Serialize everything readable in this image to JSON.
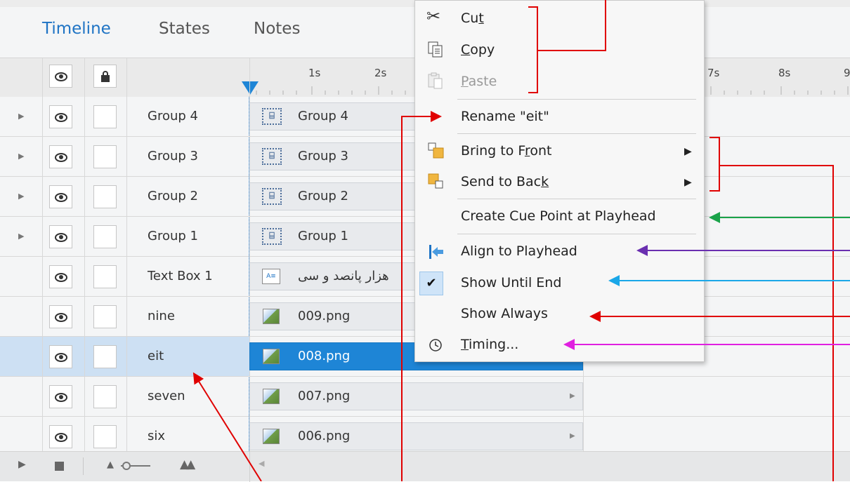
{
  "tabs": [
    {
      "label": "Timeline",
      "active": true
    },
    {
      "label": "States",
      "active": false
    },
    {
      "label": "Notes",
      "active": false
    }
  ],
  "ruler": {
    "ticks": [
      "1s",
      "2s",
      "7s",
      "8s",
      "9"
    ]
  },
  "layers": [
    {
      "name": "Group 4",
      "expandable": true,
      "bar_label": "Group  4",
      "bar_icon": "group-icon"
    },
    {
      "name": "Group 3",
      "expandable": true,
      "bar_label": "Group  3",
      "bar_icon": "group-icon"
    },
    {
      "name": "Group 2",
      "expandable": true,
      "bar_label": "Group  2",
      "bar_icon": "group-icon"
    },
    {
      "name": "Group 1",
      "expandable": true,
      "bar_label": "Group  1",
      "bar_icon": "group-icon"
    },
    {
      "name": "Text Box 1",
      "expandable": false,
      "bar_label": "هزار پانصد و سی",
      "bar_icon": "textbox-icon"
    },
    {
      "name": "nine",
      "expandable": false,
      "bar_label": "009.png",
      "bar_icon": "image-icon"
    },
    {
      "name": "eit",
      "expandable": false,
      "bar_label": "008.png",
      "bar_icon": "image-icon",
      "selected": true
    },
    {
      "name": "seven",
      "expandable": false,
      "bar_label": "007.png",
      "bar_icon": "image-icon"
    },
    {
      "name": "six",
      "expandable": false,
      "bar_label": "006.png",
      "bar_icon": "image-icon"
    }
  ],
  "context_menu": {
    "items": [
      {
        "label_pre": "Cu",
        "label_ul": "t",
        "label_post": "",
        "icon": "scissors-icon",
        "disabled": false
      },
      {
        "label_pre": "",
        "label_ul": "C",
        "label_post": "opy",
        "icon": "copy-icon",
        "disabled": false
      },
      {
        "label_pre": "",
        "label_ul": "P",
        "label_post": "aste",
        "icon": "paste-icon",
        "disabled": true
      },
      {
        "label": "Rename \"eit\"",
        "icon": "",
        "disabled": false
      },
      {
        "label_pre": "Bring to F",
        "label_ul": "r",
        "label_post": "ont",
        "icon": "bring-to-front-icon",
        "submenu": true
      },
      {
        "label_pre": "Send to Bac",
        "label_ul": "k",
        "label_post": "",
        "icon": "send-to-back-icon",
        "submenu": true
      },
      {
        "label": "Create Cue Point at Playhead",
        "icon": ""
      },
      {
        "label": "Align to Playhead",
        "icon": "align-to-playhead-icon"
      },
      {
        "label": "Show Until End",
        "icon": "checkmark-icon",
        "checked": true
      },
      {
        "label": "Show Always",
        "icon": ""
      },
      {
        "label_pre": "",
        "label_ul": "T",
        "label_post": "iming...",
        "icon": "clock-icon"
      }
    ]
  },
  "colors": {
    "accent": "#1e73c4",
    "selected_bar": "#1e85d6",
    "selected_row": "#cde0f3",
    "annotation_red": "#e00000",
    "annotation_green": "#1aa34a",
    "annotation_purple": "#6a2fb0",
    "annotation_cyan": "#1aa7e8",
    "annotation_magenta": "#e020e0"
  }
}
